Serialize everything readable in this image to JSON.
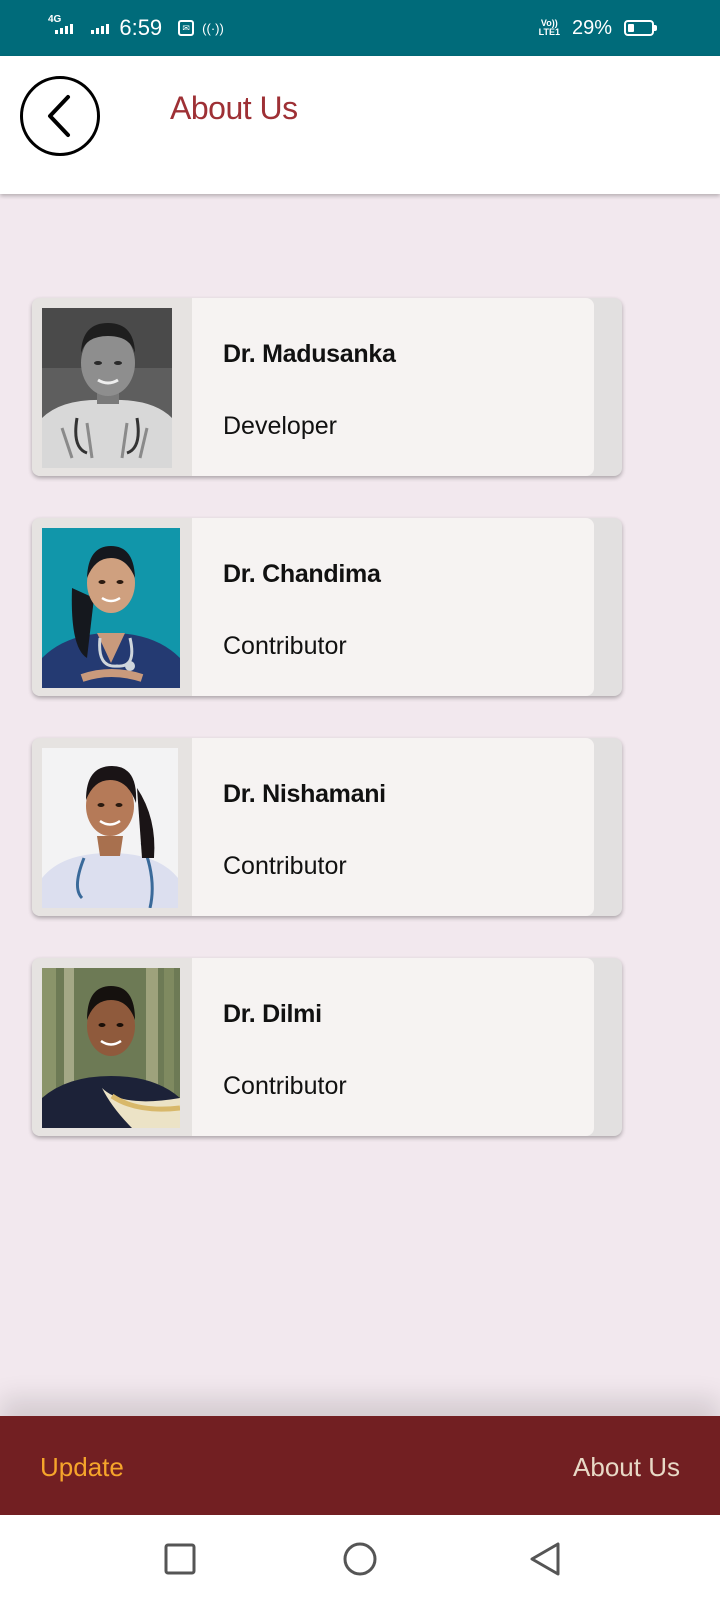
{
  "status_bar": {
    "network": "4G",
    "time": "6:59",
    "volte_top": "Vo))",
    "volte_bottom": "LTE1",
    "battery_text": "29%",
    "battery_level": 0.29,
    "notification_icon": "message-box-icon",
    "hotspot_icon": "wireless-signal-icon"
  },
  "header": {
    "title": "About Us",
    "back_icon": "chevron-left-icon",
    "title_color": "#9e3035"
  },
  "team": [
    {
      "name": "Dr. Madusanka",
      "role": "Developer",
      "photo": "grayscale-portrait"
    },
    {
      "name": "Dr. Chandima",
      "role": "Contributor",
      "photo": "teal-background-portrait"
    },
    {
      "name": "Dr. Nishamani",
      "role": "Contributor",
      "photo": "white-background-portrait"
    },
    {
      "name": "Dr. Dilmi",
      "role": "Contributor",
      "photo": "bamboo-background-portrait"
    }
  ],
  "bottom_nav": {
    "update_label": "Update",
    "about_label": "About Us",
    "bar_color": "#721f22",
    "update_color": "#f6a52b"
  },
  "system_nav": {
    "recents_icon": "square-icon",
    "home_icon": "circle-icon",
    "back_icon": "triangle-back-icon"
  },
  "colors": {
    "status_bar": "#006b7a",
    "background": "#f2e8ee",
    "card": "#f6f3f2"
  }
}
